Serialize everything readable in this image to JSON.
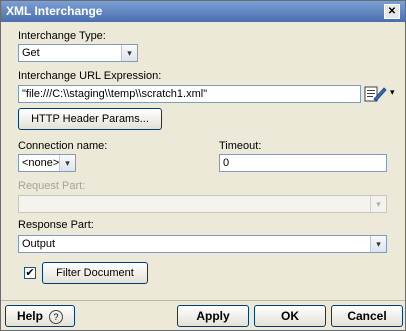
{
  "window": {
    "title": "XML Interchange",
    "close_glyph": "✕"
  },
  "interchange_type": {
    "label": "Interchange Type:",
    "value": "Get"
  },
  "url_expression": {
    "label": "Interchange URL Expression:",
    "value": "\"file:///C:\\\\staging\\\\temp\\\\scratch1.xml\""
  },
  "http_header_button": "HTTP Header Params...",
  "connection": {
    "label": "Connection name:",
    "value": "<none>"
  },
  "timeout": {
    "label": "Timeout:",
    "value": "0"
  },
  "request_part": {
    "label": "Request Part:",
    "value": "",
    "enabled": false
  },
  "response_part": {
    "label": "Response Part:",
    "value": "Output"
  },
  "filter_document": {
    "label": "Filter Document",
    "checked": true,
    "check_glyph": "✔"
  },
  "footer": {
    "help": "Help",
    "help_icon": "?",
    "apply": "Apply",
    "ok": "OK",
    "cancel": "Cancel"
  },
  "icons": {
    "expression_editor": "expression-editor-icon",
    "dropdown": "▾"
  }
}
